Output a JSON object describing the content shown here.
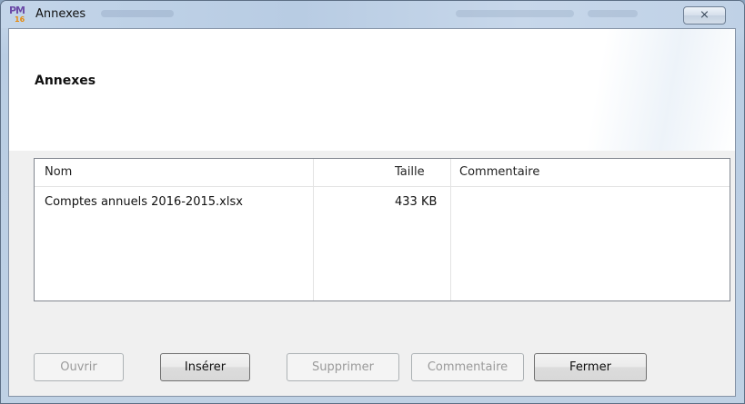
{
  "window": {
    "title": "Annexes",
    "close_glyph": "⨯",
    "app_icon_letters": "PM",
    "app_icon_number": "16"
  },
  "header": {
    "title": "Annexes"
  },
  "table": {
    "columns": [
      "Nom",
      "Taille",
      "Commentaire"
    ],
    "rows": [
      {
        "name": "Comptes annuels 2016-2015.xlsx",
        "size": "433 KB",
        "comment": ""
      }
    ]
  },
  "buttons": {
    "open": "Ouvrir",
    "insert": "Insérer",
    "delete": "Supprimer",
    "comment": "Commentaire",
    "close": "Fermer"
  }
}
